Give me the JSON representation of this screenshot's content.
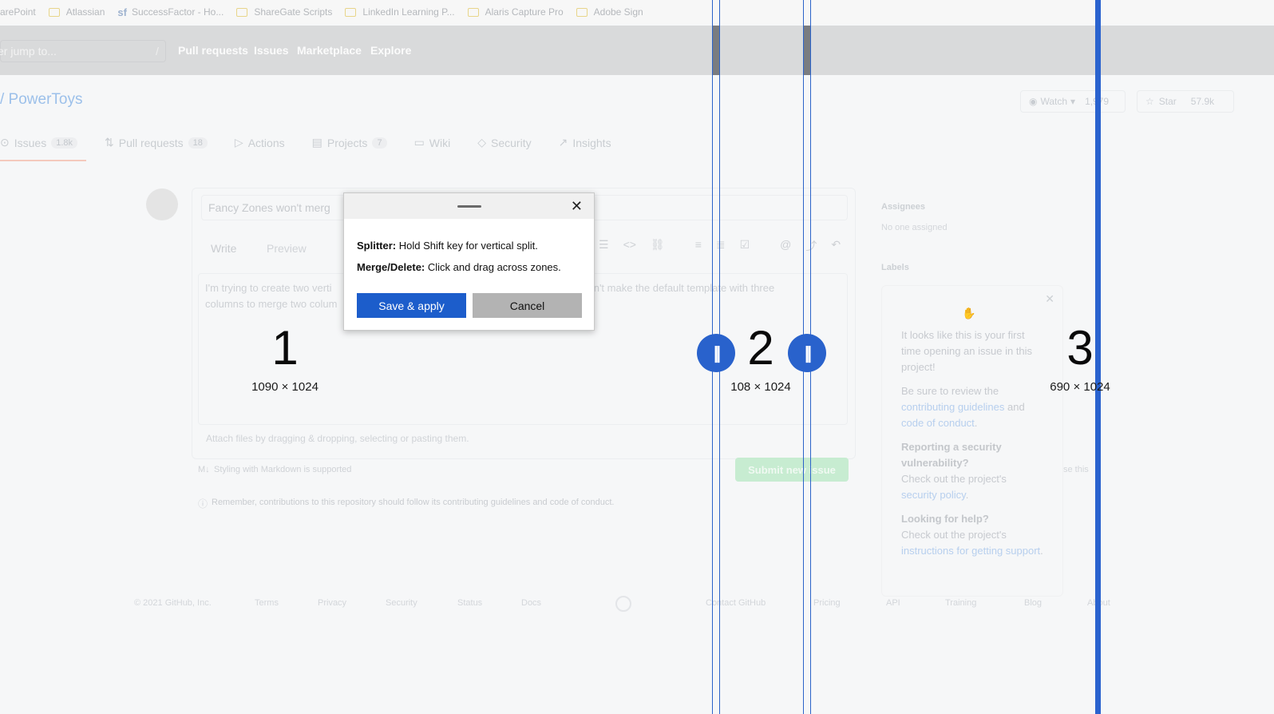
{
  "bookmarks": [
    "arePoint",
    "Atlassian",
    "SuccessFactor - Ho...",
    "ShareGate Scripts",
    "LinkedIn Learning P...",
    "Alaris Capture Pro",
    "Adobe Sign"
  ],
  "header": {
    "search_placeholder": "er jump to...",
    "search_hint": "/",
    "nav": [
      "Pull requests",
      "Issues",
      "Marketplace",
      "Explore"
    ]
  },
  "repo": {
    "title": "/ PowerToys",
    "watch_label": "Watch",
    "watch_count": "1,979",
    "star_label": "Star",
    "star_count": "57.9k"
  },
  "tabs": [
    {
      "label": "Issues",
      "count": "1.8k"
    },
    {
      "label": "Pull requests",
      "count": "18"
    },
    {
      "label": "Actions",
      "count": ""
    },
    {
      "label": "Projects",
      "count": "7"
    },
    {
      "label": "Wiki",
      "count": ""
    },
    {
      "label": "Security",
      "count": ""
    },
    {
      "label": "Insights",
      "count": ""
    }
  ],
  "issue": {
    "title_value": "Fancy Zones won't merg",
    "write_tab": "Write",
    "preview_tab": "Preview",
    "body_line1": "I'm trying to create two verti",
    "body_line1b": "t I can't make the default template with three",
    "body_line2": "columns to merge two colum",
    "attach_hint": "Attach files by dragging & dropping, selecting or pasting them.",
    "markdown_note": "Styling with Markdown is supported",
    "submit_label": "Submit new issue",
    "remember_note": "Remember, contributions to this repository should follow its contributing guidelines and code of conduct."
  },
  "sidebar": {
    "assignees_heading": "Assignees",
    "assignees_value": "No one assigned",
    "labels_heading": "Labels",
    "tip_p1": "It looks like this is your first time opening an issue in this project!",
    "tip_p2_pre": "Be sure to review the",
    "tip_p2_link1": "contributing guidelines",
    "tip_p2_mid": "and",
    "tip_p2_link2": "code of conduct",
    "tip_h3": "Reporting a security vulnerability?",
    "tip_p3_pre": "Check out the project's",
    "tip_p3_link": "security policy",
    "tip_h4": "Looking for help?",
    "tip_p4_pre": "Check out the project's",
    "tip_p4_link": "instructions for getting support",
    "side_note": "se this"
  },
  "footer": [
    "© 2021 GitHub, Inc.",
    "Terms",
    "Privacy",
    "Security",
    "Status",
    "Docs",
    "Contact GitHub",
    "Pricing",
    "API",
    "Training",
    "Blog",
    "About"
  ],
  "zones": [
    {
      "number": "1",
      "dims": "1090 × 1024"
    },
    {
      "number": "2",
      "dims": "108 × 1024"
    },
    {
      "number": "3",
      "dims": "690 × 1024"
    }
  ],
  "splitter_handle_glyph": "||",
  "dialog": {
    "splitter_label": "Splitter:",
    "splitter_text": " Hold Shift key for vertical split.",
    "merge_label": "Merge/Delete:",
    "merge_text": " Click and drag across zones.",
    "save_label": "Save & apply",
    "cancel_label": "Cancel",
    "close_glyph": "✕"
  },
  "colors": {
    "accent": "#2962cc",
    "save_button": "#1c5dcb",
    "cancel_button": "#b3b3b3"
  }
}
